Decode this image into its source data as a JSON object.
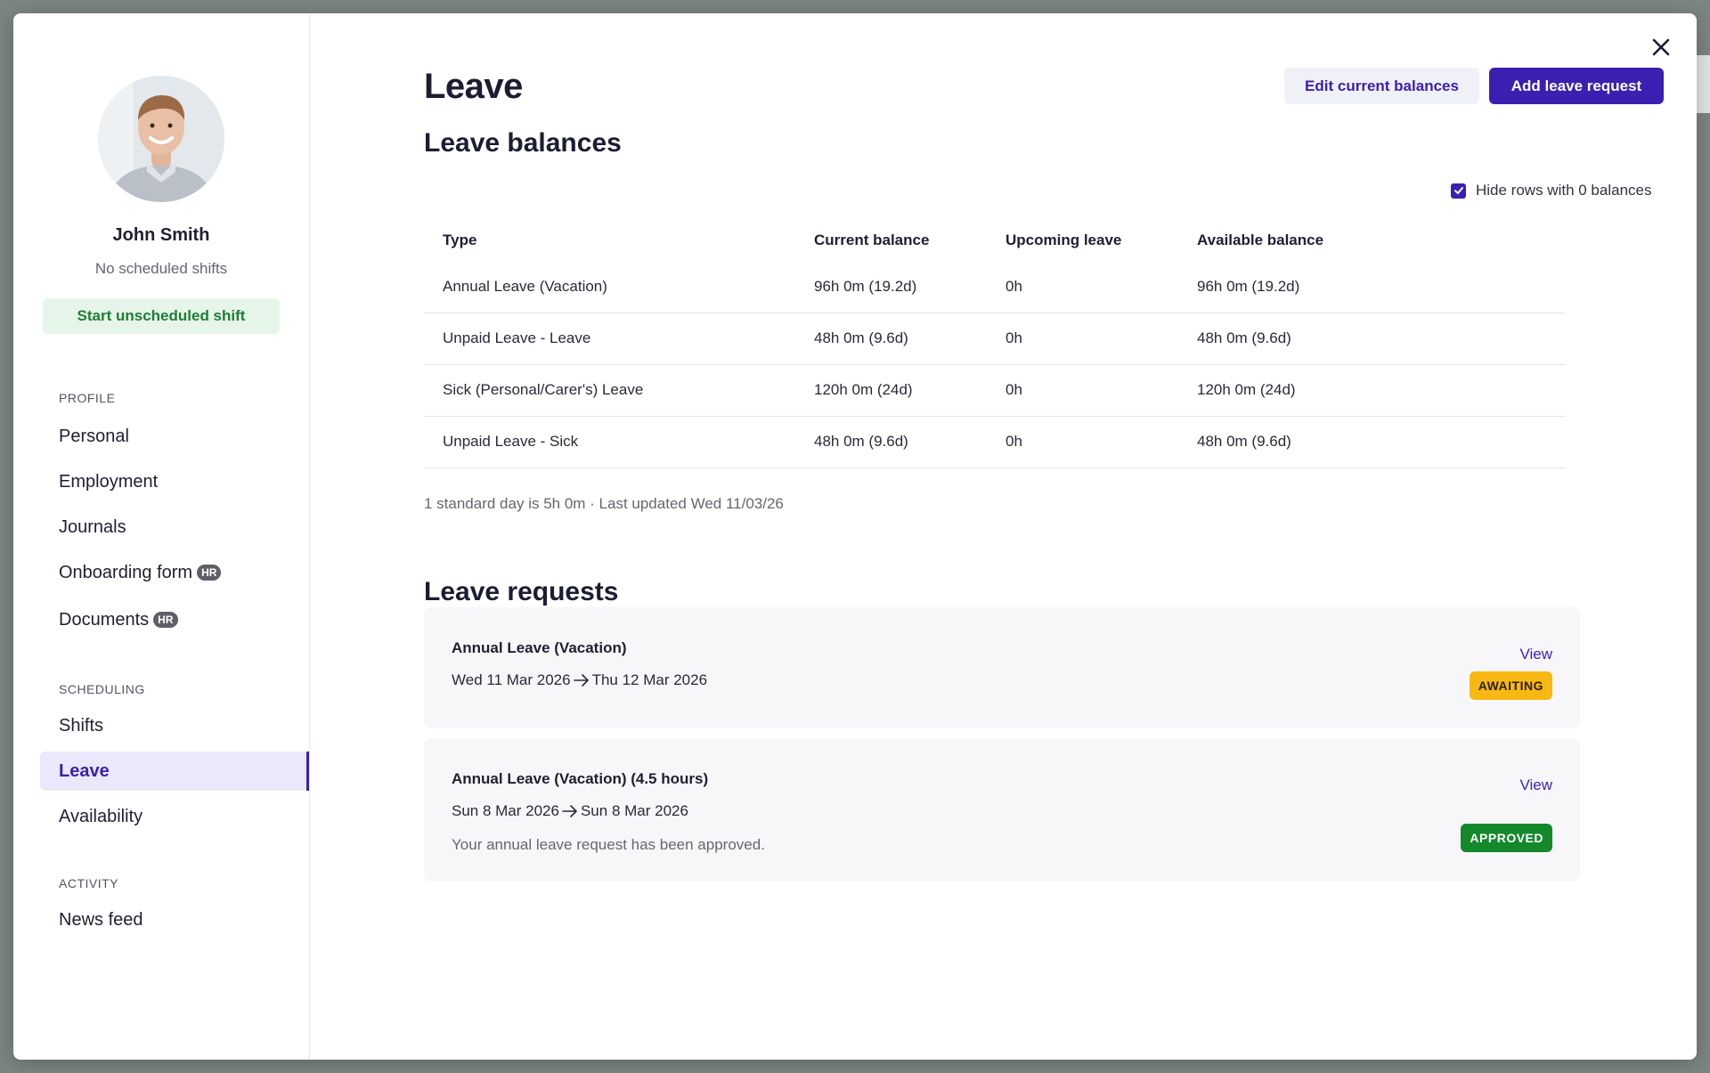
{
  "profile": {
    "name": "John Smith",
    "subtitle": "No scheduled shifts",
    "start_shift_label": "Start unscheduled shift"
  },
  "nav": {
    "profile_label": "PROFILE",
    "scheduling_label": "SCHEDULING",
    "activity_label": "ACTIVITY",
    "hr_badge": "HR",
    "items": {
      "personal": "Personal",
      "employment": "Employment",
      "journals": "Journals",
      "onboarding": "Onboarding form",
      "documents": "Documents",
      "shifts": "Shifts",
      "leave": "Leave",
      "availability": "Availability",
      "news_feed": "News feed"
    }
  },
  "header": {
    "title": "Leave",
    "edit_label": "Edit current balances",
    "add_label": "Add leave request"
  },
  "balances": {
    "title": "Leave balances",
    "hide_zero_label": "Hide rows with 0 balances",
    "hide_zero_checked": true,
    "columns": [
      "Type",
      "Current balance",
      "Upcoming leave",
      "Available balance"
    ],
    "rows": [
      [
        "Annual Leave (Vacation)",
        "96h 0m (19.2d)",
        "0h",
        "96h 0m (19.2d)"
      ],
      [
        "Unpaid Leave - Leave",
        "48h 0m (9.6d)",
        "0h",
        "48h 0m (9.6d)"
      ],
      [
        "Sick (Personal/Carer's) Leave",
        "120h 0m (24d)",
        "0h",
        "120h 0m (24d)"
      ],
      [
        "Unpaid Leave - Sick",
        "48h 0m (9.6d)",
        "0h",
        "48h 0m (9.6d)"
      ]
    ],
    "footnote": "1 standard day is 5h 0m · Last updated Wed 11/03/26"
  },
  "requests": {
    "title": "Leave requests",
    "items": [
      {
        "name": "Annual Leave (Vacation)",
        "from": "Wed 11 Mar 2026",
        "to": "Thu 12 Mar 2026",
        "note": "",
        "view_label": "View",
        "status": "AWAITING"
      },
      {
        "name": "Annual Leave (Vacation) (4.5 hours)",
        "from": "Sun 8 Mar 2026",
        "to": "Sun 8 Mar 2026",
        "note": "Your annual leave request has been approved.",
        "view_label": "View",
        "status": "APPROVED"
      }
    ]
  },
  "colors": {
    "accent": "#3b1fb0",
    "awaiting": "#f8b813",
    "approved": "#13892b",
    "start_shift_bg": "#e6f5e9"
  }
}
